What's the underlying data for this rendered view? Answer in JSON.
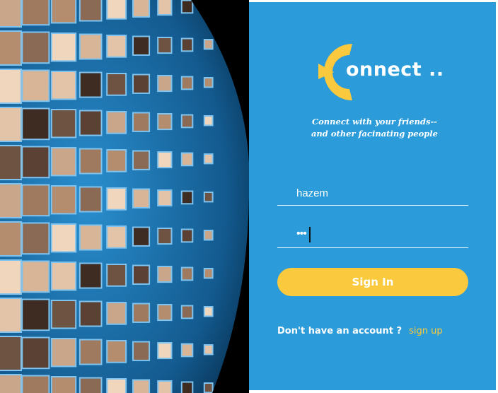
{
  "brand": {
    "logo_text": "onnect ..",
    "logo_icon": "yellow-crescent-c-logo",
    "accent_color": "#fbc93d",
    "panel_color": "#2b9bd9"
  },
  "tagline": {
    "line1": "Connect with your friends--",
    "line2": "and other facinating people"
  },
  "form": {
    "username_value": "hazem",
    "password_masked": "•••",
    "signin_label": "Sign In"
  },
  "signup": {
    "prompt": "Don't have an account ?",
    "link_label": "sign up"
  },
  "hero_image": {
    "description_icon": "globe-of-faces-image"
  }
}
